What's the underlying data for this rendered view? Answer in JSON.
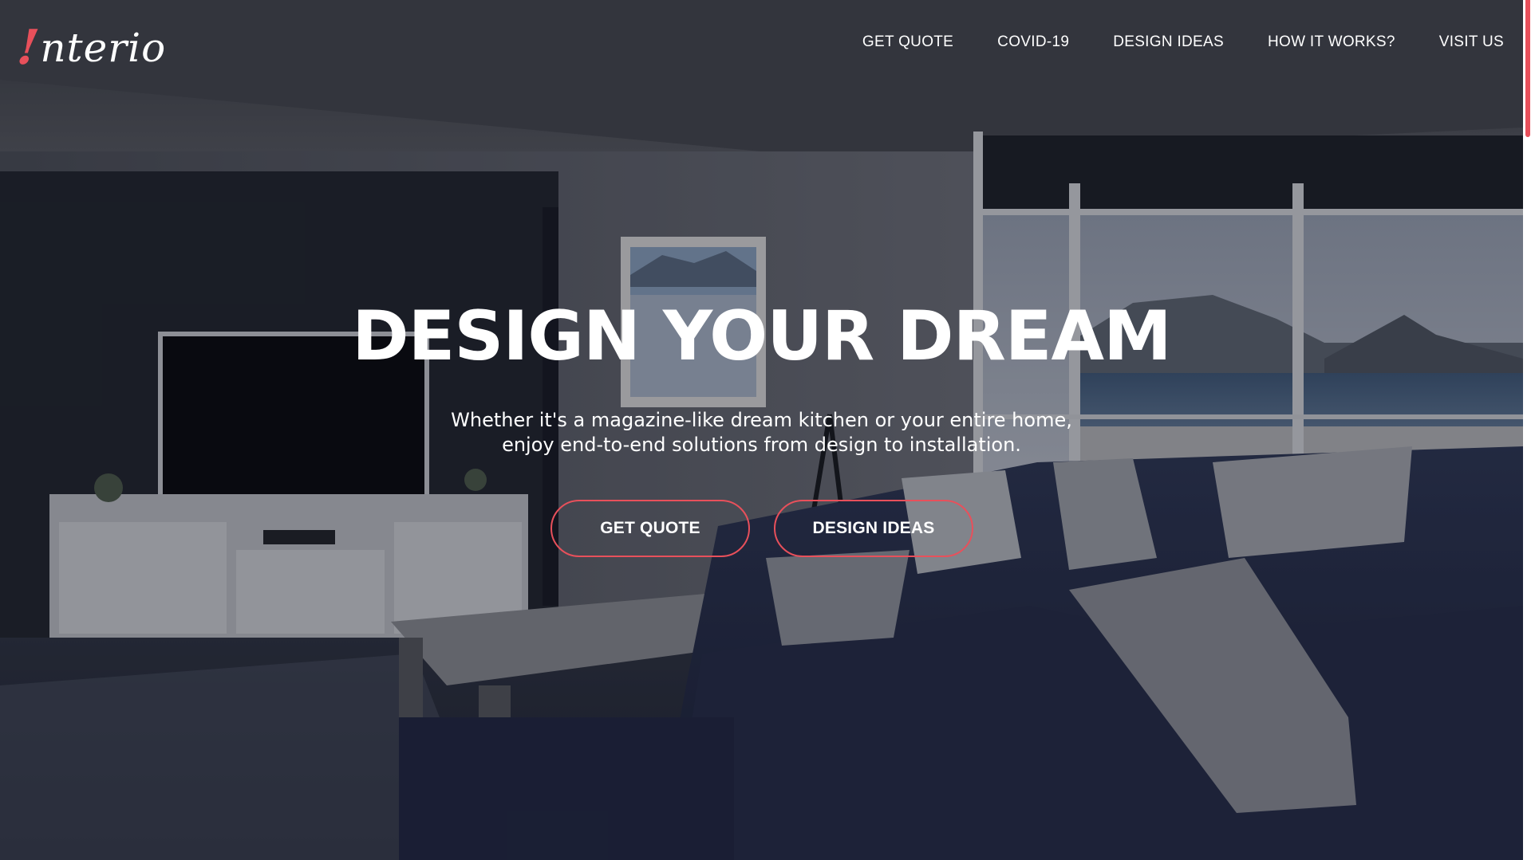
{
  "brand": {
    "logo_mark": "!",
    "logo_text": "nterio",
    "accent_color": "#e8505b"
  },
  "nav": {
    "items": [
      {
        "label": "GET QUOTE"
      },
      {
        "label": "COVID-19"
      },
      {
        "label": "DESIGN IDEAS"
      },
      {
        "label": "HOW IT WORKS?"
      },
      {
        "label": "VISIT US"
      }
    ]
  },
  "hero": {
    "title": "DESIGN YOUR DREAM",
    "subtitle_line1": "Whether it's a magazine-like dream kitchen or your entire home,",
    "subtitle_line2": "enjoy end-to-end solutions from design to installation.",
    "primary_button": "GET QUOTE",
    "secondary_button": "DESIGN IDEAS"
  }
}
